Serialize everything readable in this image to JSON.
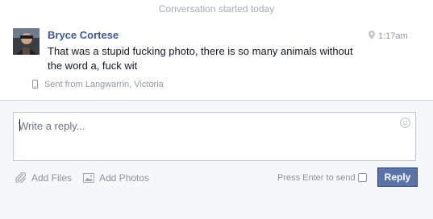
{
  "thread": {
    "started_label": "Conversation started today",
    "message": {
      "sender": "Bryce Cortese",
      "time": "1:17am",
      "text": "That was a stupid fucking photo, there is so many animals without the word a, fuck wit",
      "sent_from": "Sent from Langwarrin, Victoria"
    }
  },
  "composer": {
    "placeholder": "Write a reply...",
    "add_files_label": "Add Files",
    "add_photos_label": "Add Photos",
    "press_enter_label": "Press Enter to send",
    "press_enter_checked": false,
    "reply_label": "Reply"
  },
  "colors": {
    "sender": "#3b5998",
    "reply_button": "#5b74a8",
    "composer_bg": "#f6f7f8"
  },
  "icons": [
    "location-pin-icon",
    "mobile-phone-icon",
    "smiley-icon",
    "paperclip-icon",
    "photo-icon"
  ]
}
